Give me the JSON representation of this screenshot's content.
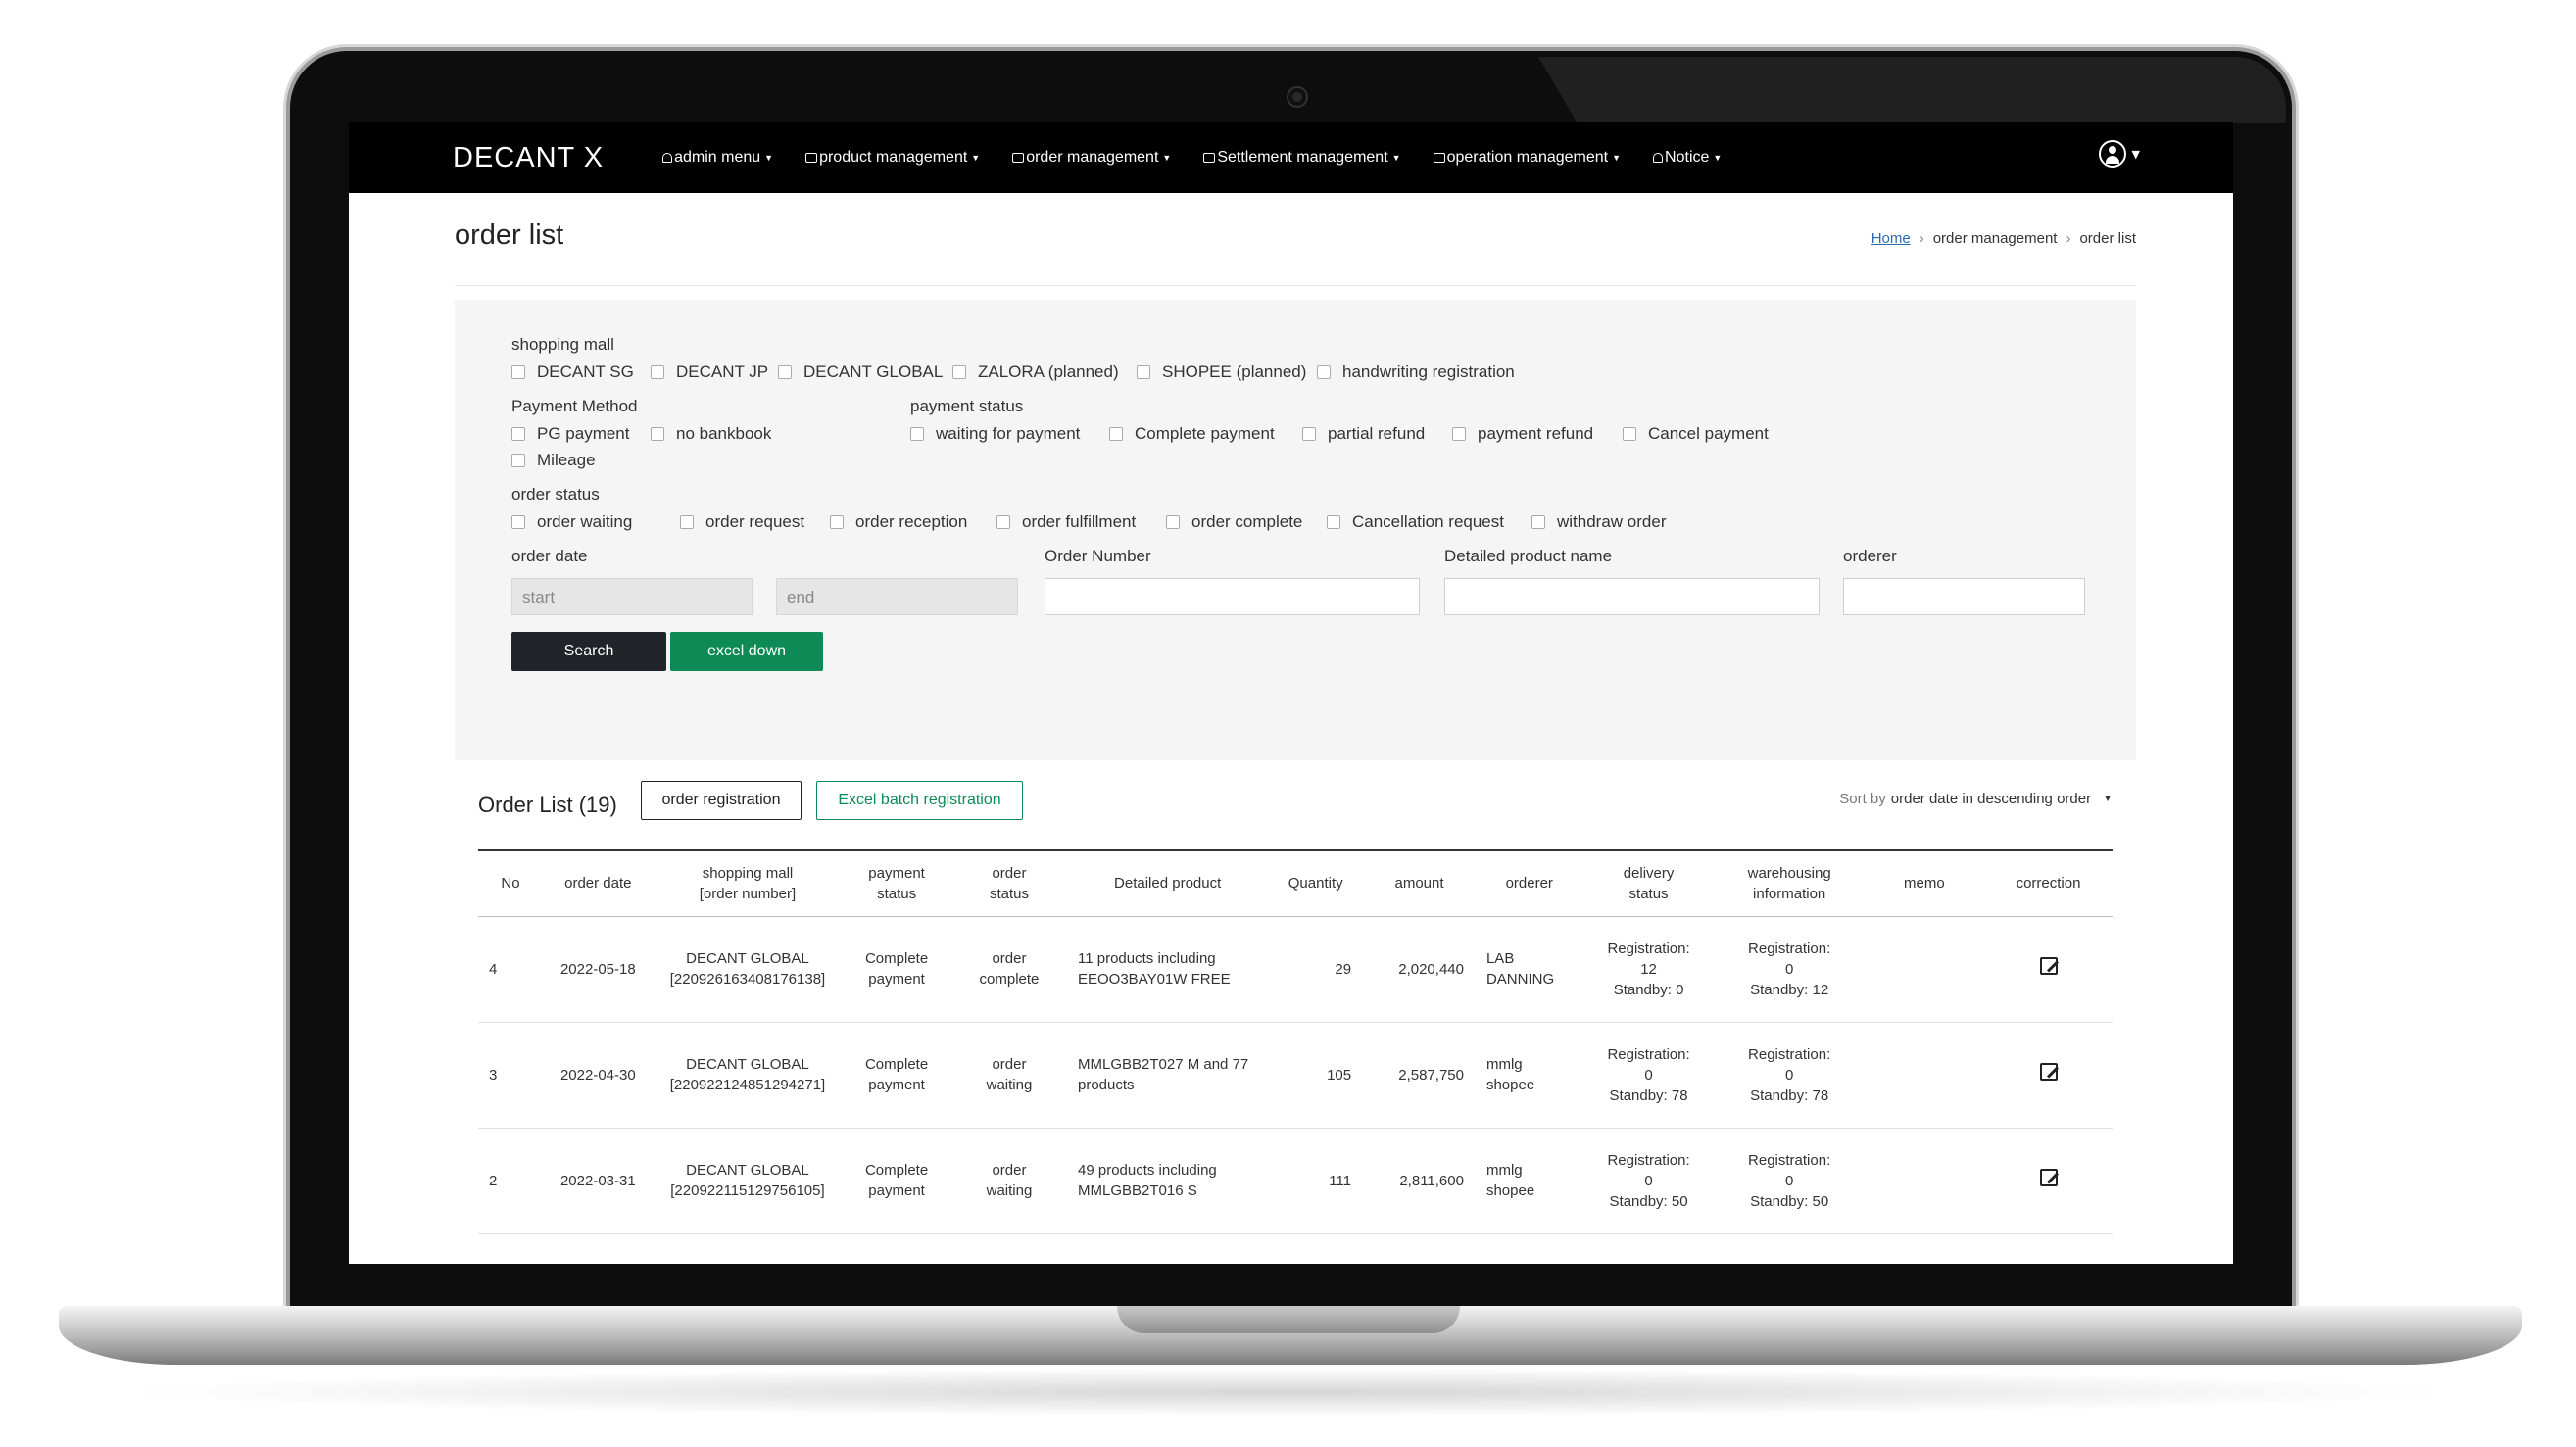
{
  "navbar": {
    "brand": "DECANT X",
    "menus": [
      {
        "label": "admin menu",
        "icon": "person-icon"
      },
      {
        "label": "product management",
        "icon": "box-icon"
      },
      {
        "label": "order management",
        "icon": "cart-icon"
      },
      {
        "label": "Settlement management",
        "icon": "card-icon"
      },
      {
        "label": "operation management",
        "icon": "window-icon"
      },
      {
        "label": "Notice",
        "icon": "bell-icon"
      }
    ],
    "user_icon": "user-circle-icon"
  },
  "page": {
    "title": "order list",
    "breadcrumb": [
      "Home",
      "order management",
      "order list"
    ]
  },
  "filters": {
    "shopping_mall": {
      "label": "shopping mall",
      "options": [
        "DECANT SG",
        "DECANT JP",
        "DECANT GLOBAL",
        "ZALORA (planned)",
        "SHOPEE (planned)",
        "handwriting registration"
      ]
    },
    "payment_method": {
      "label": "Payment Method",
      "options": [
        "PG payment",
        "no bankbook",
        "Mileage"
      ]
    },
    "payment_status": {
      "label": "payment status",
      "options": [
        "waiting for payment",
        "Complete payment",
        "partial refund",
        "payment refund",
        "Cancel payment"
      ]
    },
    "order_status": {
      "label": "order status",
      "options": [
        "order waiting",
        "order request",
        "order reception",
        "order fulfillment",
        "order complete",
        "Cancellation request",
        "withdraw order"
      ]
    },
    "order_date": {
      "label": "order date",
      "start_placeholder": "start",
      "end_placeholder": "end"
    },
    "order_number": {
      "label": "Order Number",
      "value": ""
    },
    "product_name": {
      "label": "Detailed product name",
      "value": ""
    },
    "orderer": {
      "label": "orderer",
      "value": ""
    },
    "search_label": "Search",
    "excel_label": "excel down"
  },
  "list": {
    "title": "Order List (19)",
    "register_label": "order registration",
    "batch_label": "Excel batch registration",
    "sort_prefix": "Sort by",
    "sort_value": "order date in descending order",
    "columns": [
      "No",
      "order date",
      "shopping mall",
      "[order number]",
      "payment",
      "status",
      "order",
      "status",
      "Detailed product",
      "Quantity",
      "amount",
      "orderer",
      "delivery",
      "status",
      "warehousing",
      "information",
      "memo",
      "correction"
    ],
    "rows": [
      {
        "no": "4",
        "date": "2022-05-18",
        "mall": "DECANT GLOBAL",
        "order_number": "[220926163408176138]",
        "pay1": "Complete",
        "pay2": "payment",
        "ord1": "order",
        "ord2": "complete",
        "prod1": "11 products including",
        "prod2": "EEOO3BAY01W FREE",
        "qty": "29",
        "amount": "2,020,440",
        "orderer1": "LAB",
        "orderer2": "DANNING",
        "del1": "Registration:",
        "del2": "12",
        "del3": "Standby: 0",
        "wh1": "Registration:",
        "wh2": "0",
        "wh3": "Standby: 12",
        "memo": ""
      },
      {
        "no": "3",
        "date": "2022-04-30",
        "mall": "DECANT GLOBAL",
        "order_number": "[220922124851294271]",
        "pay1": "Complete",
        "pay2": "payment",
        "ord1": "order",
        "ord2": "waiting",
        "prod1": "MMLGBB2T027 M and 77",
        "prod2": "products",
        "qty": "105",
        "amount": "2,587,750",
        "orderer1": "mmlg",
        "orderer2": "shopee",
        "del1": "Registration:",
        "del2": "0",
        "del3": "Standby: 78",
        "wh1": "Registration:",
        "wh2": "0",
        "wh3": "Standby: 78",
        "memo": ""
      },
      {
        "no": "2",
        "date": "2022-03-31",
        "mall": "DECANT GLOBAL",
        "order_number": "[220922115129756105]",
        "pay1": "Complete",
        "pay2": "payment",
        "ord1": "order",
        "ord2": "waiting",
        "prod1": "49 products including",
        "prod2": "MMLGBB2T016 S",
        "qty": "111",
        "amount": "2,811,600",
        "orderer1": "mmlg",
        "orderer2": "shopee",
        "del1": "Registration:",
        "del2": "0",
        "del3": "Standby: 50",
        "wh1": "Registration:",
        "wh2": "0",
        "wh3": "Standby: 50",
        "memo": ""
      }
    ],
    "edit_icon": "edit-icon"
  },
  "colors": {
    "navbar": "#000000",
    "primary_dark": "#212529",
    "accent_green": "#0d8a55",
    "link": "#2b6cb0"
  }
}
